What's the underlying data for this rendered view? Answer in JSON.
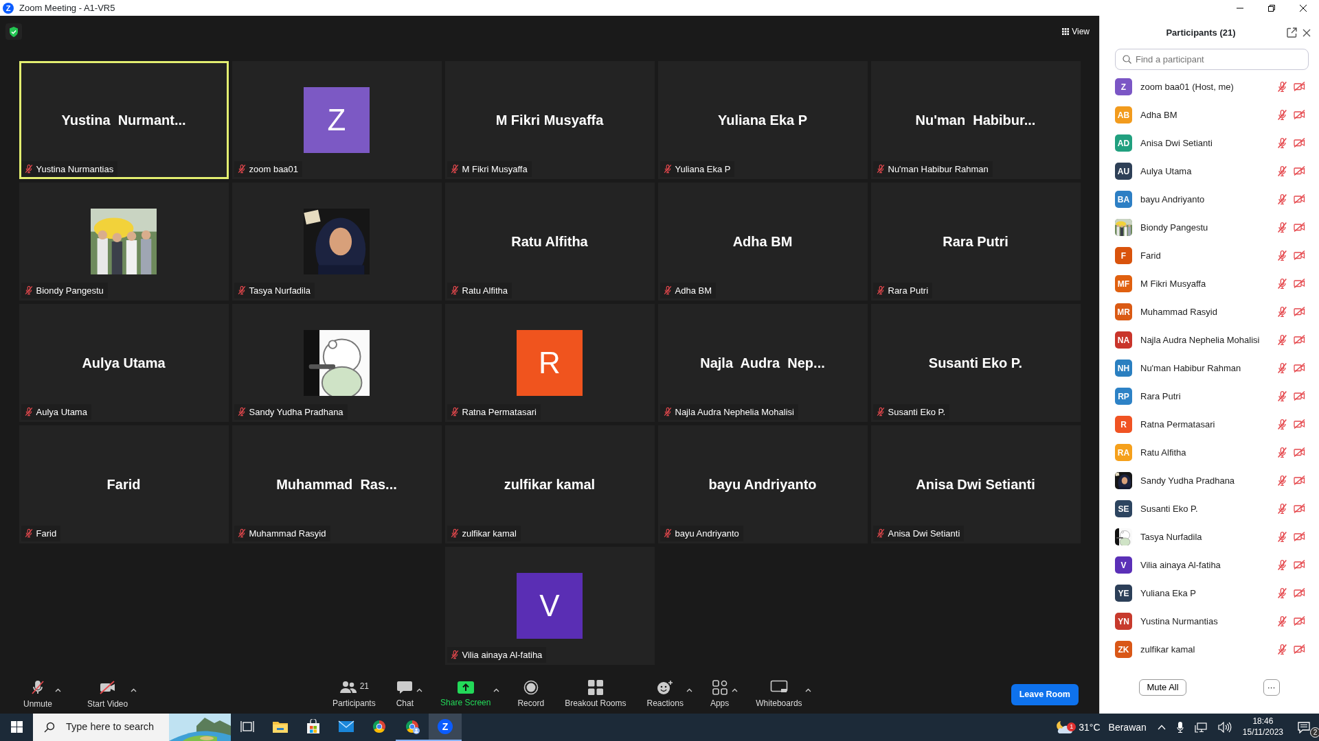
{
  "window": {
    "logo": "Z",
    "title": "Zoom Meeting - A1-VR5"
  },
  "top_bar": {
    "secure": true,
    "view_button": "View"
  },
  "tiles": [
    {
      "kind": "name",
      "display": "Yustina  Nurmant...",
      "label": "Yustina Nurmantias",
      "muted": true,
      "selected": true
    },
    {
      "kind": "avatar",
      "initial": "Z",
      "color": "#7c59c4",
      "label": "zoom baa01",
      "muted": true,
      "selected": false
    },
    {
      "kind": "name",
      "display": "M Fikri Musyaffa",
      "label": "M Fikri Musyaffa",
      "muted": true,
      "selected": false
    },
    {
      "kind": "name",
      "display": "Yuliana Eka P",
      "label": "Yuliana Eka P",
      "muted": true,
      "selected": false
    },
    {
      "kind": "name",
      "display": "Nu'man  Habibur...",
      "label": "Nu'man Habibur Rahman",
      "muted": true,
      "selected": false
    },
    {
      "kind": "picture",
      "label": "Biondy Pangestu",
      "muted": true,
      "selected": false
    },
    {
      "kind": "picture",
      "label": "Tasya Nurfadila",
      "muted": true,
      "selected": false
    },
    {
      "kind": "name",
      "display": "Ratu Alfitha",
      "label": "Ratu Alfitha",
      "muted": true,
      "selected": false
    },
    {
      "kind": "name",
      "display": "Adha BM",
      "label": "Adha BM",
      "muted": true,
      "selected": false
    },
    {
      "kind": "name",
      "display": "Rara Putri",
      "label": "Rara Putri",
      "muted": true,
      "selected": false
    },
    {
      "kind": "name",
      "display": "Aulya Utama",
      "label": "Aulya Utama",
      "muted": true,
      "selected": false
    },
    {
      "kind": "picture",
      "label": "Sandy Yudha Pradhana",
      "muted": true,
      "selected": false
    },
    {
      "kind": "avatar",
      "initial": "R",
      "color": "#f0541e",
      "label": "Ratna Permatasari",
      "muted": true,
      "selected": false
    },
    {
      "kind": "name",
      "display": "Najla  Audra  Nep...",
      "label": "Najla Audra Nephelia Mohalisi",
      "muted": true,
      "selected": false
    },
    {
      "kind": "name",
      "display": "Susanti Eko P.",
      "label": "Susanti Eko P.",
      "muted": true,
      "selected": false
    },
    {
      "kind": "name",
      "display": "Farid",
      "label": "Farid",
      "muted": true,
      "selected": false
    },
    {
      "kind": "name",
      "display": "Muhammad  Ras...",
      "label": "Muhammad Rasyid",
      "muted": true,
      "selected": false
    },
    {
      "kind": "name",
      "display": "zulfikar kamal",
      "label": "zulfikar kamal",
      "muted": true,
      "selected": false
    },
    {
      "kind": "name",
      "display": "bayu Andriyanto",
      "label": "bayu Andriyanto",
      "muted": true,
      "selected": false
    },
    {
      "kind": "name",
      "display": "Anisa Dwi Setianti",
      "label": "Anisa Dwi Setianti",
      "muted": true,
      "selected": false
    },
    {
      "kind": "avatar",
      "initial": "V",
      "color": "#5a2eb4",
      "label": "Vilia ainaya Al-fatiha",
      "muted": true,
      "selected": false
    }
  ],
  "toolbar": {
    "left": [
      {
        "kind": "mic",
        "label": "Unmute",
        "caret": true
      },
      {
        "kind": "video",
        "label": "Start Video",
        "caret": true
      }
    ],
    "center": [
      {
        "kind": "participants",
        "label": "Participants",
        "count": "21",
        "caret": false
      },
      {
        "kind": "chat",
        "label": "Chat",
        "caret": true
      },
      {
        "kind": "share",
        "label": "Share Screen",
        "caret": true
      },
      {
        "kind": "record",
        "label": "Record",
        "caret": false
      },
      {
        "kind": "breakout",
        "label": "Breakout Rooms",
        "caret": false
      },
      {
        "kind": "reactions",
        "label": "Reactions",
        "caret": true
      },
      {
        "kind": "apps",
        "label": "Apps",
        "caret": true
      },
      {
        "kind": "whiteboard",
        "label": "Whiteboards",
        "caret": true
      }
    ],
    "leave_button": "Leave Room"
  },
  "participants": {
    "title": "Participants (21)",
    "search": {
      "placeholder": "Find a participant"
    },
    "items": [
      {
        "kind": "initials",
        "initials": "Z",
        "color": "#7b56c5",
        "name": "zoom baa01 (Host, me)",
        "muted": true,
        "video_off": true
      },
      {
        "kind": "initials",
        "initials": "AB",
        "color": "#f29b1d",
        "name": "Adha BM",
        "muted": true,
        "video_off": true
      },
      {
        "kind": "initials",
        "initials": "AD",
        "color": "#21a07f",
        "name": "Anisa Dwi Setianti",
        "muted": true,
        "video_off": true
      },
      {
        "kind": "initials",
        "initials": "AU",
        "color": "#2e4057",
        "name": "Aulya Utama",
        "muted": true,
        "video_off": true
      },
      {
        "kind": "initials",
        "initials": "BA",
        "color": "#2d7fc4",
        "name": "bayu Andriyanto",
        "muted": true,
        "video_off": true
      },
      {
        "kind": "picture",
        "name": "Biondy Pangestu",
        "muted": true,
        "video_off": true
      },
      {
        "kind": "initials",
        "initials": "F",
        "color": "#d9530c",
        "name": "Farid",
        "muted": true,
        "video_off": true
      },
      {
        "kind": "initials",
        "initials": "MF",
        "color": "#e0600f",
        "name": "M Fikri Musyaffa",
        "muted": true,
        "video_off": true
      },
      {
        "kind": "initials",
        "initials": "MR",
        "color": "#da5a14",
        "name": "Muhammad Rasyid",
        "muted": true,
        "video_off": true
      },
      {
        "kind": "initials",
        "initials": "NA",
        "color": "#c9352b",
        "name": "Najla Audra Nephelia Mohalisi",
        "muted": true,
        "video_off": true
      },
      {
        "kind": "initials",
        "initials": "NH",
        "color": "#2a7fc0",
        "name": "Nu'man Habibur Rahman",
        "muted": true,
        "video_off": true
      },
      {
        "kind": "initials",
        "initials": "RP",
        "color": "#2d82c6",
        "name": "Rara Putri",
        "muted": true,
        "video_off": true
      },
      {
        "kind": "initials",
        "initials": "R",
        "color": "#f05323",
        "name": "Ratna Permatasari",
        "muted": true,
        "video_off": true
      },
      {
        "kind": "initials",
        "initials": "RA",
        "color": "#f5a01b",
        "name": "Ratu Alfitha",
        "muted": true,
        "video_off": true
      },
      {
        "kind": "picture",
        "name": "Sandy Yudha Pradhana",
        "muted": true,
        "video_off": true
      },
      {
        "kind": "initials",
        "initials": "SE",
        "color": "#2d4560",
        "name": "Susanti Eko P.",
        "muted": true,
        "video_off": true
      },
      {
        "kind": "picture",
        "name": "Tasya Nurfadila",
        "muted": true,
        "video_off": true
      },
      {
        "kind": "initials",
        "initials": "V",
        "color": "#5b30b7",
        "name": "Vilia ainaya Al-fatiha",
        "muted": true,
        "video_off": true
      },
      {
        "kind": "initials",
        "initials": "YE",
        "color": "#2c3f58",
        "name": "Yuliana Eka P",
        "muted": true,
        "video_off": true
      },
      {
        "kind": "initials",
        "initials": "YN",
        "color": "#c73a2d",
        "name": "Yustina Nurmantias",
        "muted": true,
        "video_off": true
      },
      {
        "kind": "initials",
        "initials": "ZK",
        "color": "#d95717",
        "name": "zulfikar kamal",
        "muted": true,
        "video_off": true
      }
    ],
    "mute_all_button": "Mute All",
    "more_button": "···"
  },
  "taskbar": {
    "search": {
      "placeholder": "Type here to search"
    },
    "apps": [
      {
        "kind": "taskview",
        "running": false,
        "selected": false
      },
      {
        "kind": "explorer",
        "running": false,
        "selected": false
      },
      {
        "kind": "store",
        "running": false,
        "selected": false
      },
      {
        "kind": "mail",
        "running": false,
        "selected": false
      },
      {
        "kind": "chrome",
        "running": false,
        "selected": false
      },
      {
        "kind": "chrome_profile",
        "running": true,
        "selected": false
      },
      {
        "kind": "zoom",
        "letter": "Z",
        "running": true,
        "selected": true
      }
    ],
    "weather": {
      "badge": "1",
      "temperature": "31°C",
      "condition": "Berawan"
    },
    "time": "18:46",
    "date": "15/11/2023",
    "notifications": "2"
  }
}
